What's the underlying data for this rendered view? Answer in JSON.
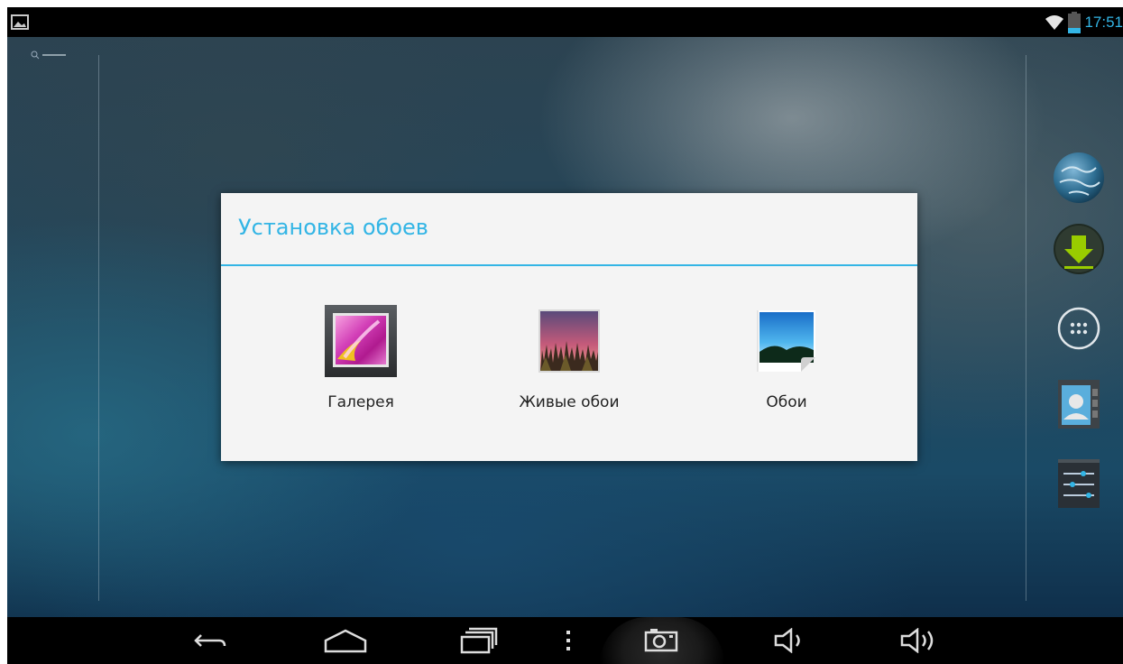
{
  "status_bar": {
    "time": "17:51",
    "notification_icon": "image-notification-icon",
    "wifi_icon": "wifi-icon",
    "battery_icon": "battery-icon",
    "accent_color": "#33b5e5"
  },
  "dialog": {
    "title": "Установка обоев",
    "options": [
      {
        "label": "Галерея",
        "icon": "gallery-icon"
      },
      {
        "label": "Живые обои",
        "icon": "live-wallpapers-icon"
      },
      {
        "label": "Обои",
        "icon": "wallpapers-icon"
      }
    ]
  },
  "dock": {
    "icons": [
      "browser-globe-icon",
      "download-icon",
      "all-apps-icon",
      "contacts-icon",
      "settings-icon"
    ]
  },
  "nav_bar": {
    "buttons": [
      "back-icon",
      "home-icon",
      "recent-apps-icon",
      "menu-icon",
      "screenshot-icon",
      "volume-down-icon",
      "volume-up-icon"
    ]
  }
}
